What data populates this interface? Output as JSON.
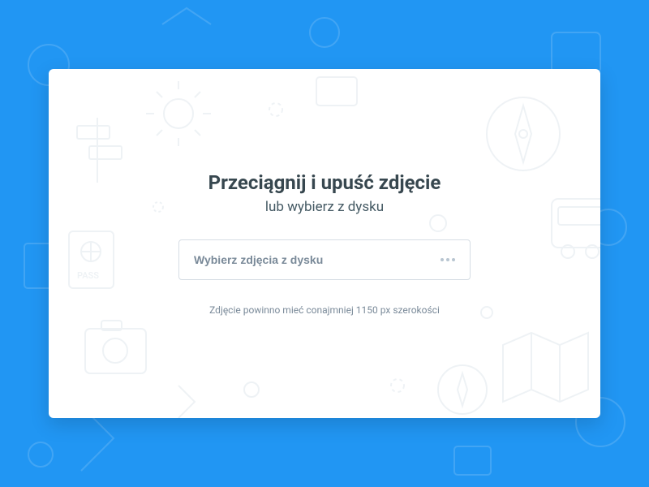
{
  "upload": {
    "title": "Przeciągnij i upuść zdjęcie",
    "subtitle": "lub wybierz z dysku",
    "button_label": "Wybierz zdjęcia z dysku",
    "hint": "Zdjęcie powinno mieć conajmniej 1150 px szerokości"
  }
}
